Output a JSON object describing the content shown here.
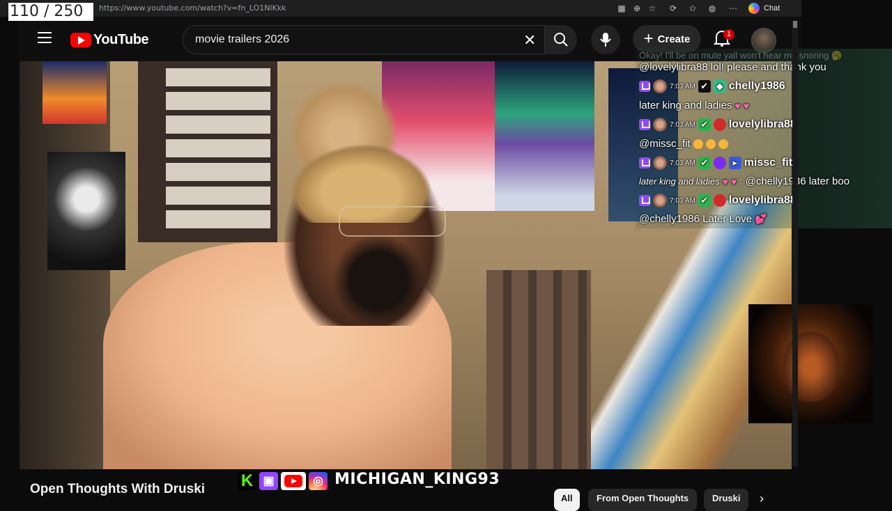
{
  "overlay": {
    "counter": "110 / 250"
  },
  "browser": {
    "url": "https://www.youtube.com/watch?v=fn_LO1NlKkk",
    "chat_label": "Chat"
  },
  "youtube": {
    "logo_text": "YouTube",
    "search_value": "movie trailers 2026",
    "create_label": "Create",
    "notification_count": "1",
    "video_title": "Open Thoughts With Druski",
    "chips": [
      "All",
      "From Open Thoughts",
      "Druski"
    ]
  },
  "stream": {
    "channel_handle": "MICHIGAN_KING93"
  },
  "chat": {
    "top_partial": "Okay! I'll be on mute yall won't hear me snoring 🥱",
    "messages": [
      {
        "text": "@lovelylibra88 lol! please and thank you"
      },
      {
        "time": "7:03 AM",
        "user": "chelly1986",
        "user_color": "#ffffff"
      },
      {
        "text": "later king and ladies"
      },
      {
        "time": "7:03 AM",
        "user": "lovelylibra88",
        "user_color": "#ffffff"
      },
      {
        "text": "@missc_fit"
      },
      {
        "time": "7:03 AM",
        "user": "missc_fit",
        "user_color": "#ffffff"
      },
      {
        "text_italic": "later king and ladies",
        "text": ": @chelly1986 later boo"
      },
      {
        "time": "7:03 AM",
        "user": "lovelylibra88",
        "user_color": "#ffffff"
      },
      {
        "text": "@chelly1986 Later Love"
      }
    ]
  },
  "colors": {
    "yt_red": "#ff0000",
    "twitch_purple": "#9146ff",
    "kick_green": "#53fc18"
  }
}
